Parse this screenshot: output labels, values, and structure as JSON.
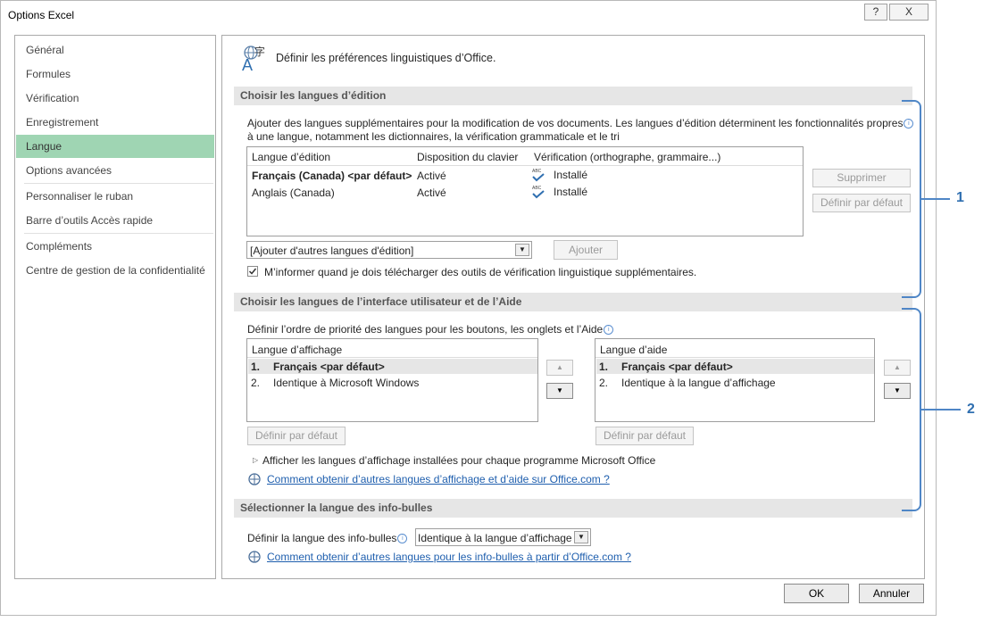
{
  "window": {
    "title": "Options Excel",
    "help_label": "?",
    "close_label": "X"
  },
  "sidebar": {
    "items": [
      {
        "label": "Général"
      },
      {
        "label": "Formules"
      },
      {
        "label": "Vérification"
      },
      {
        "label": "Enregistrement"
      },
      {
        "label": "Langue"
      },
      {
        "label": "Options avancées"
      },
      {
        "label": "Personnaliser le ruban"
      },
      {
        "label": "Barre d’outils Accès rapide"
      },
      {
        "label": "Compléments"
      },
      {
        "label": "Centre de gestion de la confidentialité"
      }
    ],
    "selected": "Langue"
  },
  "header": {
    "title": "Définir les préférences linguistiques d’Office."
  },
  "editing": {
    "section_title": "Choisir les langues d’édition",
    "description_line1": "Ajouter des langues supplémentaires pour la modification de vos documents. Les langues d’édition déterminent les fonctionnalités propres",
    "description_line2": "à une langue, notamment les dictionnaires, la vérification grammaticale et le tri",
    "columns": [
      "Langue d’édition",
      "Disposition du clavier",
      "Vérification (orthographe, grammaire...)"
    ],
    "rows": [
      {
        "language": "Français (Canada) <par défaut>",
        "keyboard": "Activé",
        "proofing": "Installé"
      },
      {
        "language": "Anglais (Canada)",
        "keyboard": "Activé",
        "proofing": "Installé"
      }
    ],
    "proofing_icon_text": "ABC",
    "remove_button": "Supprimer",
    "set_default_button": "Définir par défaut",
    "add_dropdown_value": "[Ajouter d'autres langues d'édition]",
    "add_button": "Ajouter",
    "notify_checkbox": "M’informer quand je dois télécharger des outils de vérification linguistique supplémentaires.",
    "notify_checked": true
  },
  "display": {
    "section_title": "Choisir les langues de l’interface utilisateur et de l’Aide",
    "description": "Définir l’ordre de priorité des langues pour les boutons, les onglets et l’Aide",
    "display_list": {
      "header": "Langue d’affichage",
      "items": [
        {
          "num": "1.",
          "label": "Français <par défaut>"
        },
        {
          "num": "2.",
          "label": "Identique à Microsoft Windows"
        }
      ]
    },
    "help_list": {
      "header": "Langue d’aide",
      "items": [
        {
          "num": "1.",
          "label": "Français <par défaut>"
        },
        {
          "num": "2.",
          "label": "Identique à la langue d’affichage"
        }
      ]
    },
    "set_default_display": "Définir par défaut",
    "set_default_help": "Définir par défaut",
    "expand_label": "Afficher les langues d’affichage installées pour chaque programme Microsoft Office",
    "link": "Comment obtenir d’autres langues d’affichage et d’aide sur Office.com ?"
  },
  "tooltips": {
    "section_title": "Sélectionner la langue des info-bulles",
    "label": "Définir la langue des info-bulles",
    "dropdown_value": "Identique à la langue d’affichage",
    "link": "Comment obtenir d’autres langues pour les info-bulles à partir d’Office.com ?"
  },
  "footer": {
    "ok": "OK",
    "cancel": "Annuler"
  },
  "callouts": {
    "one": "1",
    "two": "2"
  },
  "colors": {
    "selected_nav": "#9fd5b3",
    "callout": "#2f6fb0",
    "link": "#1f5fae"
  }
}
